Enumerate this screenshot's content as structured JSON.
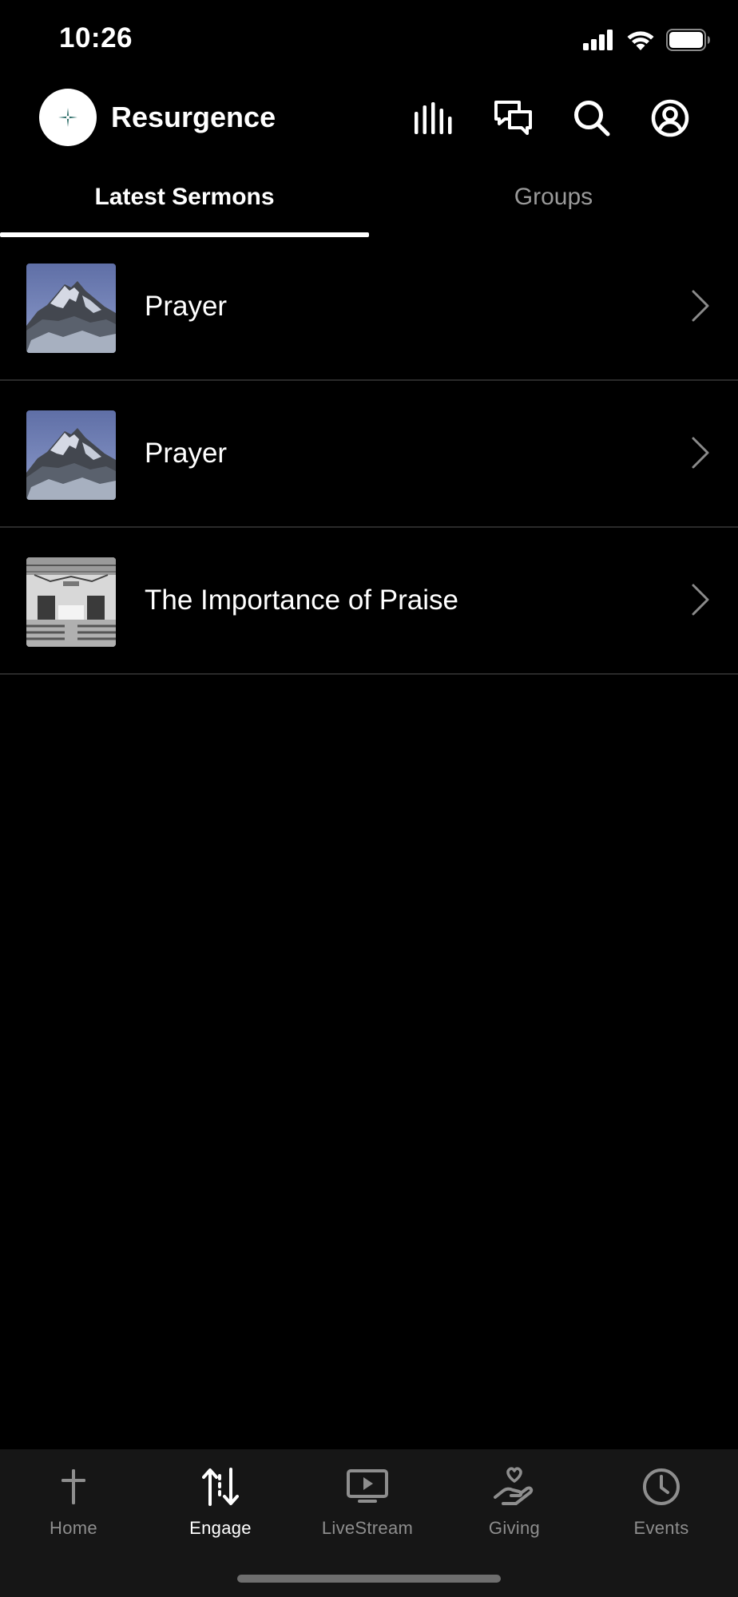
{
  "status_bar": {
    "time": "10:26",
    "icons": [
      "signal-icon",
      "wifi-icon",
      "battery-icon"
    ]
  },
  "header": {
    "app_title": "Resurgence",
    "logo_icon": "resurgence-logo-icon",
    "actions": [
      "audio-bars-icon",
      "chat-bubbles-icon",
      "search-icon",
      "user-account-icon"
    ]
  },
  "tabs": [
    {
      "label": "Latest Sermons",
      "active": true
    },
    {
      "label": "Groups",
      "active": false
    }
  ],
  "sermons": [
    {
      "title": "Prayer",
      "thumbnail": "mountain-peak"
    },
    {
      "title": "Prayer",
      "thumbnail": "mountain-peak"
    },
    {
      "title": "The Importance of Praise",
      "thumbnail": "church-interior"
    }
  ],
  "tabbar": {
    "items": [
      {
        "label": "Home",
        "icon": "cross-icon",
        "active": false
      },
      {
        "label": "Engage",
        "icon": "arrows-up-down-icon",
        "active": true
      },
      {
        "label": "LiveStream",
        "icon": "play-screen-icon",
        "active": false
      },
      {
        "label": "Giving",
        "icon": "hand-heart-icon",
        "active": false
      },
      {
        "label": "Events",
        "icon": "clock-icon",
        "active": false
      }
    ]
  },
  "colors": {
    "background": "#000000",
    "tabbar_background": "#161616",
    "active_text": "#ffffff",
    "inactive_text": "#8e8e8e",
    "divider": "#2a2a2a"
  }
}
